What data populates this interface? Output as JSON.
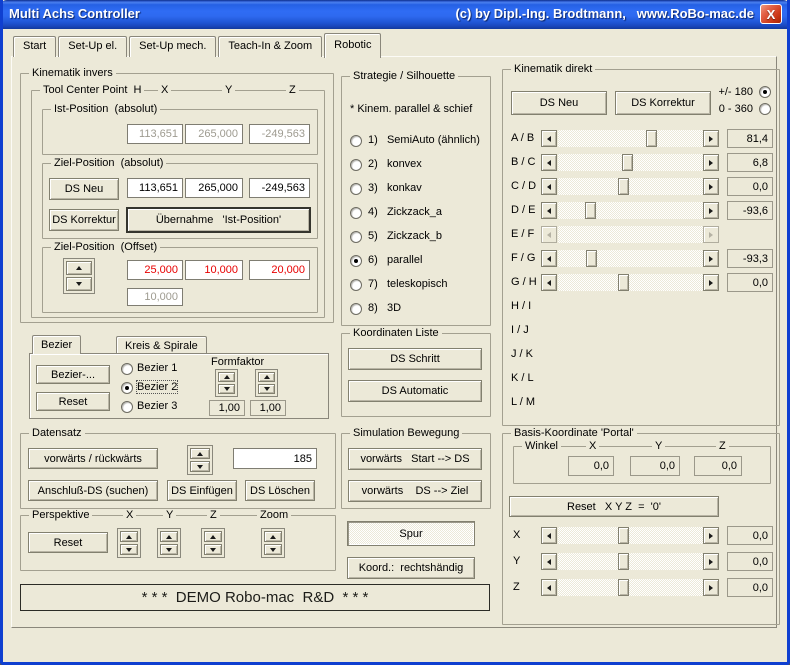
{
  "colors": {
    "titlebar_blue": "#2f6cf4",
    "window_border_blue": "#0f3fd0",
    "offset_text_red": "#e80000",
    "background": "#ece9d8"
  },
  "window": {
    "title": "Multi Achs Controller",
    "credit": "(c) by Dipl.-Ing. Brodtmann,   www.RoBo-mac.de",
    "close_label": "X"
  },
  "tabs": {
    "items": [
      "Start",
      "Set-Up el.",
      "Set-Up mech.",
      "Teach-In & Zoom",
      "Robotic"
    ],
    "active": "Robotic"
  },
  "kin": {
    "title": "Kinematik invers",
    "tcp_title": "Tool Center Point  H",
    "headers": [
      "X",
      "Y",
      "Z"
    ],
    "ist": {
      "title": "Ist-Position  (absolut)",
      "values": [
        "113,651",
        "265,000",
        "-249,563"
      ]
    },
    "ziel": {
      "title": "Ziel-Position  (absolut)",
      "ds_neu": "DS Neu",
      "ds_korrektur": "DS Korrektur",
      "uebernahme": "Übernahme   'Ist-Position'",
      "values": [
        "113,651",
        "265,000",
        "-249,563"
      ]
    },
    "offset": {
      "title": "Ziel-Position  (Offset)",
      "values": [
        "25,000",
        "10,000",
        "20,000"
      ],
      "extra": "10,000"
    }
  },
  "bezier": {
    "tab1": "Bezier",
    "tab2": "Kreis & Spirale",
    "btn_bezier": "Bezier-...",
    "btn_reset": "Reset",
    "radios": [
      {
        "label": "Bezier 1",
        "checked": false
      },
      {
        "label": "Bezier 2",
        "checked": true
      },
      {
        "label": "Bezier 3",
        "checked": false
      }
    ],
    "formfaktor_label": "Formfaktor",
    "formfaktor_values": [
      "1,00",
      "1,00"
    ]
  },
  "datensatz": {
    "title": "Datensatz",
    "btn_vor": "vorwärts / rückwärts",
    "value": "185",
    "btn_anschluss": "Anschluß-DS (suchen)",
    "btn_einfuegen": "DS Einfügen",
    "btn_loeschen": "DS Löschen"
  },
  "perspektive": {
    "title": "Perspektive",
    "reset": "Reset",
    "axes": [
      "X",
      "Y",
      "Z",
      "Zoom"
    ]
  },
  "demo": "* * *  DEMO Robo-mac  R&D  * * *",
  "strategie": {
    "title": "Strategie / Silhouette",
    "subtitle": "* Kinem. parallel & schief",
    "options": [
      {
        "label": "1)   SemiAuto (ähnlich)",
        "checked": false
      },
      {
        "label": "2)   konvex",
        "checked": false
      },
      {
        "label": "3)   konkav",
        "checked": false
      },
      {
        "label": "4)   Zickzack_a",
        "checked": false
      },
      {
        "label": "5)   Zickzack_b",
        "checked": false
      },
      {
        "label": "6)   parallel",
        "checked": true
      },
      {
        "label": "7)   teleskopisch",
        "checked": false
      },
      {
        "label": "8)   3D",
        "checked": false
      }
    ]
  },
  "koordliste": {
    "title": "Koordinaten Liste",
    "btn_schritt": "DS Schritt",
    "btn_automatic": "DS Automatic"
  },
  "simulation": {
    "title": "Simulation Bewegung",
    "btn1": "vorwärts   Start --> DS",
    "btn2": "vorwärts    DS --> Ziel"
  },
  "spur": "Spur",
  "koord": "Koord.:  rechtshändig",
  "kind": {
    "title": "Kinematik direkt",
    "ds_neu": "DS Neu",
    "ds_korrektur": "DS Korrektur",
    "range": [
      {
        "label": "+/- 180",
        "checked": true
      },
      {
        "label": "0 - 360",
        "checked": false
      }
    ],
    "rows": [
      {
        "label": "A / B",
        "value": "81,4",
        "pos": 0.66
      },
      {
        "label": "B / C",
        "value": "6,8",
        "pos": 0.48
      },
      {
        "label": "C / D",
        "value": "0,0",
        "pos": 0.45
      },
      {
        "label": "D / E",
        "value": "-93,6",
        "pos": 0.2
      },
      {
        "label": "E / F"
      },
      {
        "label": "F / G",
        "value": "-93,3",
        "pos": 0.21
      },
      {
        "label": "G / H",
        "value": "0,0",
        "pos": 0.45
      },
      {
        "label": "H / I"
      },
      {
        "label": "I / J"
      },
      {
        "label": "J / K"
      },
      {
        "label": "K / L"
      },
      {
        "label": "L / M"
      }
    ]
  },
  "basis": {
    "title": "Basis-Koordinate 'Portal'",
    "winkel_title": "Winkel",
    "winkel_headers": [
      "X",
      "Y",
      "Z"
    ],
    "winkel_values": [
      "0,0",
      "0,0",
      "0,0"
    ],
    "reset": "Reset   X Y Z  =  '0'",
    "rows": [
      {
        "label": "X",
        "value": "0,0",
        "pos": 0.45
      },
      {
        "label": "Y",
        "value": "0,0",
        "pos": 0.45
      },
      {
        "label": "Z",
        "value": "0,0",
        "pos": 0.45
      }
    ]
  }
}
